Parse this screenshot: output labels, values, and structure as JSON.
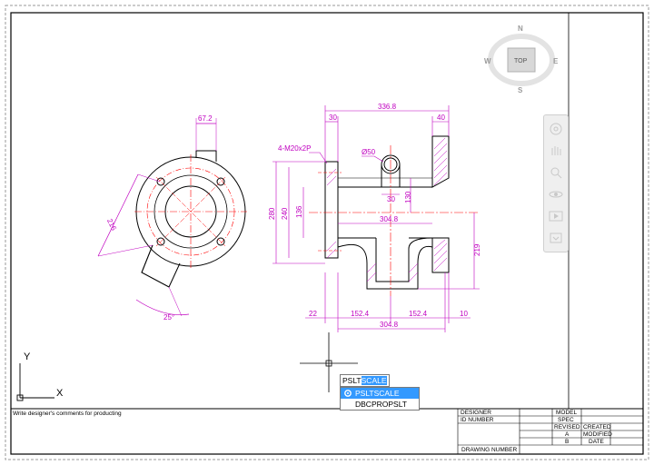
{
  "viewcube": {
    "north": "N",
    "south": "S",
    "east": "E",
    "west": "W",
    "face": "TOP"
  },
  "ucs": {
    "x": "X",
    "y": "Y"
  },
  "dimensions": {
    "side_width": "67.2",
    "side_dia": "216",
    "side_angle": "25°",
    "total_length": "336.8",
    "flange_left": "30",
    "flange_right": "40",
    "holes": "4-M20x2P",
    "hole_dia": "Ø50",
    "dim_30": "30",
    "dim_130": "130",
    "dim_280": "280",
    "dim_240": "240",
    "dim_136": "136",
    "inner_length": "304.8",
    "height_219": "219",
    "bottom_22": "22",
    "bottom_152_left": "152.4",
    "bottom_152_right": "152.4",
    "bottom_10": "10",
    "bottom_total": "304.8"
  },
  "command": {
    "typed": "PSLT",
    "completion": "SCALE",
    "suggestions": [
      "PSLTSCALE",
      "DBCPROPSLT"
    ]
  },
  "title_block": {
    "comment": "Write designer's comments for producting",
    "designer": "DESIGNER",
    "id_number": "ID NUMBER",
    "model": "MODEL",
    "spec": "SPEC",
    "revised": "REVISED",
    "created": "CREATED",
    "rev_a": "A",
    "modified": "MODIFIED",
    "rev_b": "B",
    "date": "DATE",
    "drawing_number": "DRAWING NUMBER"
  }
}
